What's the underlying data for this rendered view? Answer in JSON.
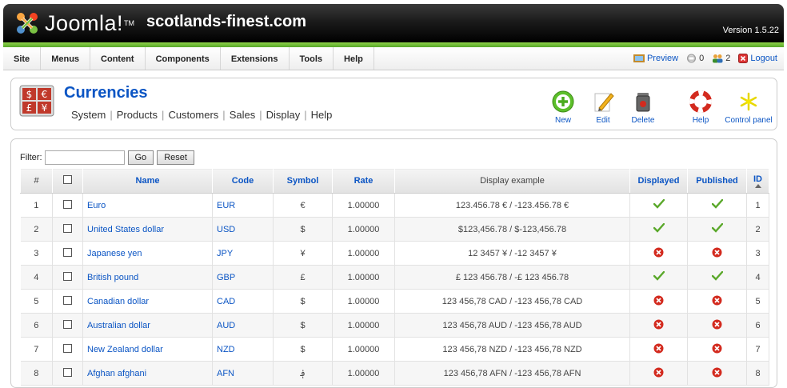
{
  "header": {
    "logo_text": "Joomla!",
    "site_title": "scotlands-finest.com",
    "version": "Version 1.5.22"
  },
  "menu": {
    "items": [
      "Site",
      "Menus",
      "Content",
      "Components",
      "Extensions",
      "Tools",
      "Help"
    ],
    "preview": "Preview",
    "messages_count": "0",
    "users_count": "2",
    "logout": "Logout"
  },
  "toolbar": {
    "title": "Currencies",
    "submenu": [
      "System",
      "Products",
      "Customers",
      "Sales",
      "Display",
      "Help"
    ],
    "buttons": {
      "new": "New",
      "edit": "Edit",
      "delete": "Delete",
      "help": "Help",
      "control_panel": "Control panel"
    }
  },
  "filter": {
    "label": "Filter:",
    "value": "",
    "go": "Go",
    "reset": "Reset"
  },
  "table": {
    "headers": [
      "#",
      "Name",
      "Code",
      "Symbol",
      "Rate",
      "Display example",
      "Displayed",
      "Published",
      "ID"
    ],
    "rows": [
      {
        "num": "1",
        "name": "Euro",
        "code": "EUR",
        "symbol": "€",
        "rate": "1.00000",
        "example": "123.456.78 € / -123.456.78 €",
        "displayed": true,
        "published": true,
        "id": "1"
      },
      {
        "num": "2",
        "name": "United States dollar",
        "code": "USD",
        "symbol": "$",
        "rate": "1.00000",
        "example": "$123,456.78 / $-123,456.78",
        "displayed": true,
        "published": true,
        "id": "2"
      },
      {
        "num": "3",
        "name": "Japanese yen",
        "code": "JPY",
        "symbol": "¥",
        "rate": "1.00000",
        "example": "12 3457 ¥ / -12 3457 ¥",
        "displayed": false,
        "published": false,
        "id": "3"
      },
      {
        "num": "4",
        "name": "British pound",
        "code": "GBP",
        "symbol": "£",
        "rate": "1.00000",
        "example": "£ 123 456.78 / -£ 123 456.78",
        "displayed": true,
        "published": true,
        "id": "4"
      },
      {
        "num": "5",
        "name": "Canadian dollar",
        "code": "CAD",
        "symbol": "$",
        "rate": "1.00000",
        "example": "123 456,78 CAD / -123 456,78 CAD",
        "displayed": false,
        "published": false,
        "id": "5"
      },
      {
        "num": "6",
        "name": "Australian dollar",
        "code": "AUD",
        "symbol": "$",
        "rate": "1.00000",
        "example": "123 456,78 AUD / -123 456,78 AUD",
        "displayed": false,
        "published": false,
        "id": "6"
      },
      {
        "num": "7",
        "name": "New Zealand dollar",
        "code": "NZD",
        "symbol": "$",
        "rate": "1.00000",
        "example": "123 456,78 NZD / -123 456,78 NZD",
        "displayed": false,
        "published": false,
        "id": "7"
      },
      {
        "num": "8",
        "name": "Afghan afghani",
        "code": "AFN",
        "symbol": "؋",
        "rate": "1.00000",
        "example": "123 456,78 AFN / -123 456,78 AFN",
        "displayed": false,
        "published": false,
        "id": "8"
      }
    ]
  },
  "colors": {
    "link": "#0b55c4",
    "green_strip": "#6cbb3c",
    "check": "#5aa82a",
    "cross": "#d32a1e"
  }
}
